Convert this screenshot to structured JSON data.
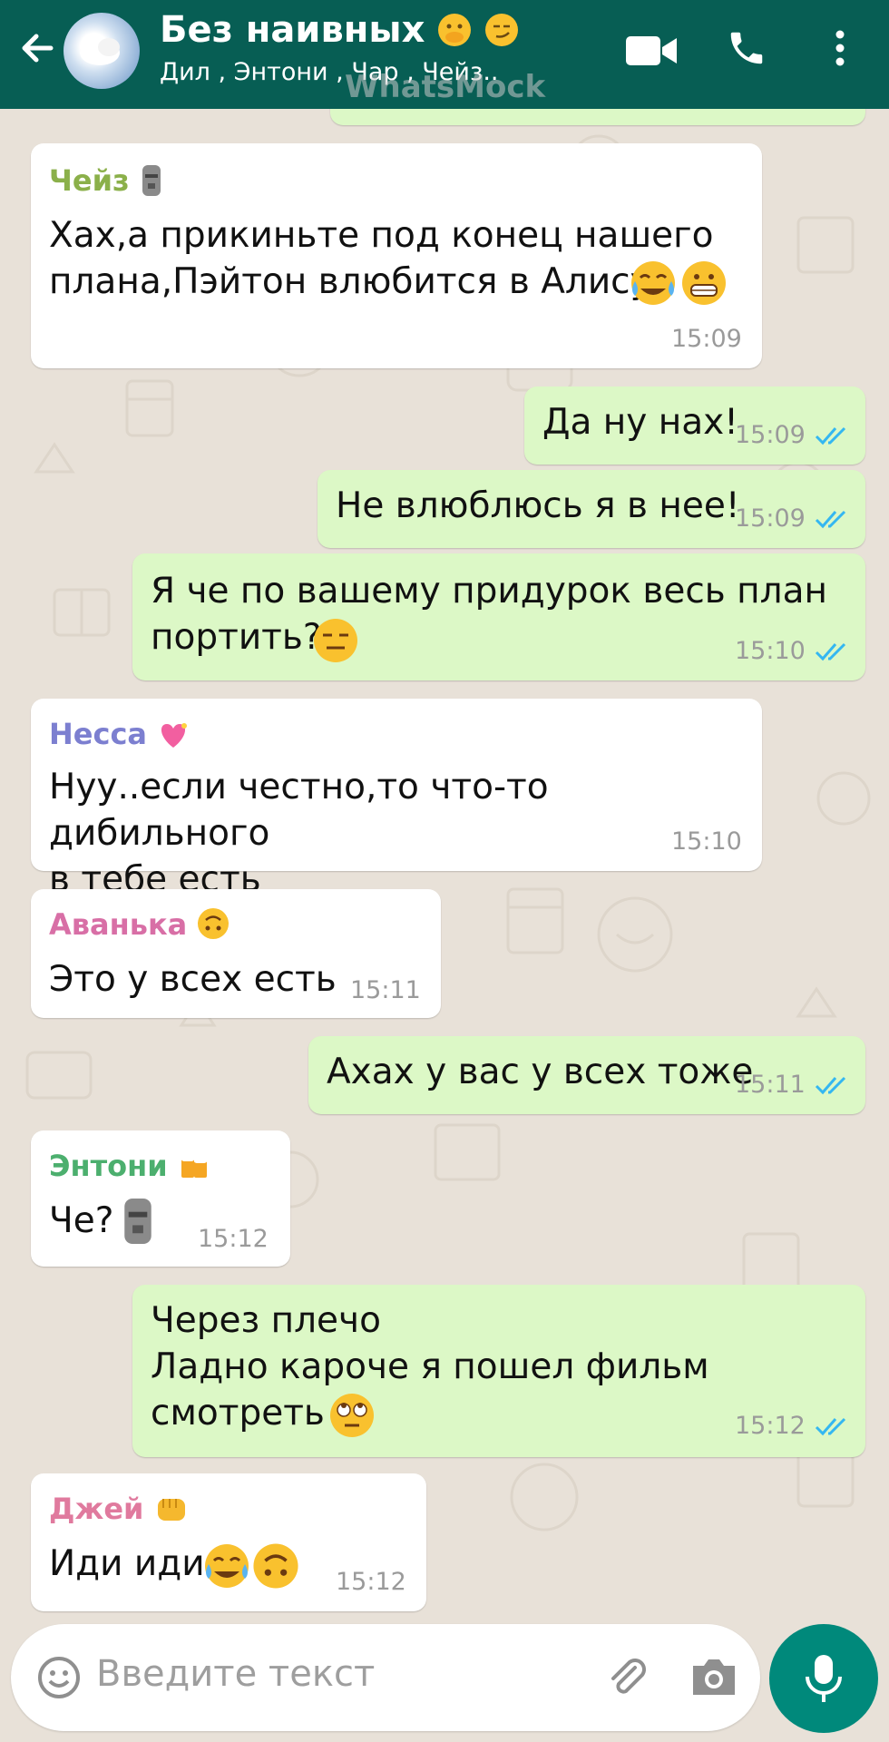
{
  "header": {
    "title": "Без наивных",
    "subtitle": "Дил  , Энтони  , Чар  , Чейз..",
    "watermark": "WhatsMock",
    "icons": [
      "back-arrow-icon",
      "video-call-icon",
      "phone-icon",
      "more-vert-icon"
    ],
    "color": "#075e54"
  },
  "messages": [
    {
      "sender": "Чейз",
      "sender_color": "#8bb04a",
      "text": "Хах,а прикиньте под конец нашего\nплана,Пэйтон влюбится в Алису",
      "time": "15:09",
      "direction": "incoming"
    },
    {
      "text": "Да ну нах!",
      "time": "15:09",
      "direction": "outgoing",
      "status": "read"
    },
    {
      "text": "Не влюблюсь я в нее!",
      "time": "15:09",
      "direction": "outgoing",
      "status": "read"
    },
    {
      "text": "Я че по вашему придурок весь план\nпортить?",
      "time": "15:10",
      "direction": "outgoing",
      "status": "read"
    },
    {
      "sender": "Несса",
      "sender_color": "#7c7fd0",
      "text": "Нуу..если честно,то что-то дибильного\nв тебе есть",
      "time": "15:10",
      "direction": "incoming"
    },
    {
      "sender": "Аванька",
      "sender_color": "#d86fa6",
      "text": "Это у всех есть",
      "time": "15:11",
      "direction": "incoming"
    },
    {
      "text": "Ахах у вас у всех тоже",
      "time": "15:11",
      "direction": "outgoing",
      "status": "read"
    },
    {
      "sender": "Энтони",
      "sender_color": "#4caf6e",
      "text": "Че?",
      "time": "15:12",
      "direction": "incoming"
    },
    {
      "text": "Через плечо\nЛадно кароче я пошел фильм\nсмотреть",
      "time": "15:12",
      "direction": "outgoing",
      "status": "read"
    },
    {
      "sender": "Джей",
      "sender_color": "#e07a9e",
      "text": "Иди иди",
      "time": "15:12",
      "direction": "incoming"
    }
  ],
  "input": {
    "placeholder": "Введите текст",
    "icons": [
      "emoji-icon",
      "attach-icon",
      "camera-icon",
      "mic-icon"
    ]
  },
  "colors": {
    "incoming": "#ffffff",
    "outgoing": "#dcf8c6",
    "tick": "#34b7f1",
    "mic_button": "#00897b"
  }
}
